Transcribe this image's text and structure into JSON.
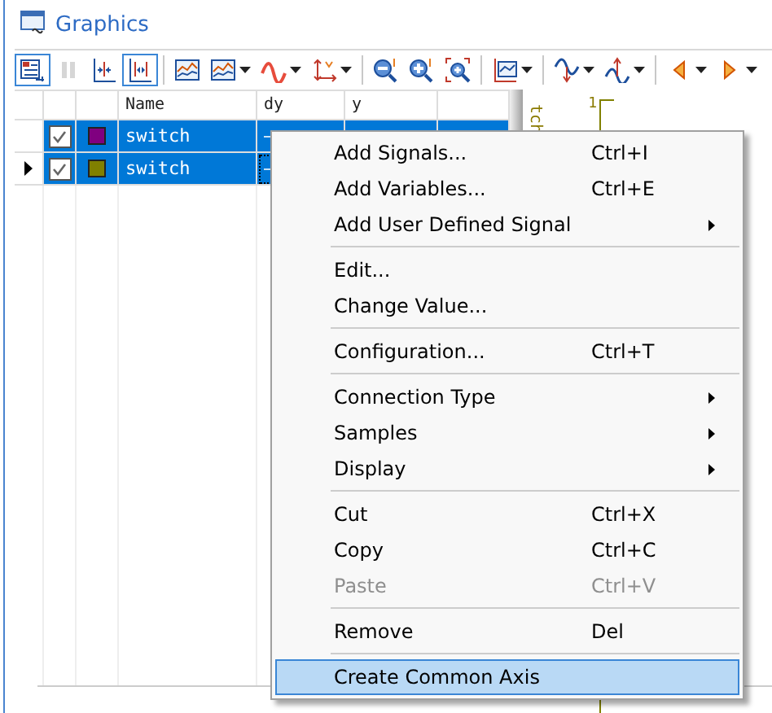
{
  "window": {
    "title": "Graphics"
  },
  "toolbar": [
    {
      "kind": "signal-list",
      "selected": true,
      "disabled": false,
      "dropdown": false
    },
    {
      "kind": "pause",
      "selected": false,
      "disabled": true,
      "dropdown": false
    },
    {
      "kind": "fit-x",
      "selected": false,
      "disabled": false,
      "dropdown": false
    },
    {
      "kind": "fit-x-marks",
      "selected": true,
      "disabled": false,
      "dropdown": false
    },
    {
      "kind": "separator"
    },
    {
      "kind": "chart",
      "selected": false,
      "disabled": false,
      "dropdown": false
    },
    {
      "kind": "chart",
      "selected": false,
      "disabled": false,
      "dropdown": true
    },
    {
      "kind": "wave",
      "selected": false,
      "disabled": false,
      "dropdown": true
    },
    {
      "kind": "xy-arrows",
      "selected": false,
      "disabled": false,
      "dropdown": true
    },
    {
      "kind": "separator"
    },
    {
      "kind": "zoom-out",
      "selected": false,
      "disabled": false,
      "dropdown": false
    },
    {
      "kind": "zoom-in",
      "selected": false,
      "disabled": false,
      "dropdown": false
    },
    {
      "kind": "zoom-rect",
      "selected": false,
      "disabled": false,
      "dropdown": false
    },
    {
      "kind": "separator"
    },
    {
      "kind": "axis-chart",
      "selected": false,
      "disabled": false,
      "dropdown": true
    },
    {
      "kind": "separator"
    },
    {
      "kind": "wave-down",
      "selected": false,
      "disabled": false,
      "dropdown": true
    },
    {
      "kind": "wave-up",
      "selected": false,
      "disabled": false,
      "dropdown": true
    },
    {
      "kind": "separator"
    },
    {
      "kind": "prev",
      "selected": false,
      "disabled": false,
      "dropdown": true
    },
    {
      "kind": "next",
      "selected": false,
      "disabled": false,
      "dropdown": true
    }
  ],
  "table": {
    "columns": [
      "Name",
      "dy",
      "y"
    ],
    "rows": [
      {
        "checked": true,
        "color": "#800080",
        "name": "switch",
        "dy": "–",
        "selected": true,
        "current": false
      },
      {
        "checked": true,
        "color": "#808000",
        "name": "switch",
        "dy": "–",
        "selected": true,
        "current": true
      }
    ]
  },
  "plot": {
    "signal_label": "tch",
    "tick": "1"
  },
  "context_menu": [
    {
      "kind": "item",
      "label": "Add Signals...",
      "shortcut": "Ctrl+I",
      "submenu": false,
      "disabled": false,
      "selected": false
    },
    {
      "kind": "item",
      "label": "Add Variables...",
      "shortcut": "Ctrl+E",
      "submenu": false,
      "disabled": false,
      "selected": false
    },
    {
      "kind": "item",
      "label": "Add User Defined Signal",
      "submenu": true,
      "disabled": false,
      "selected": false
    },
    {
      "kind": "separator"
    },
    {
      "kind": "item",
      "label": "Edit...",
      "submenu": false,
      "disabled": false,
      "selected": false
    },
    {
      "kind": "item",
      "label": "Change Value...",
      "submenu": false,
      "disabled": false,
      "selected": false
    },
    {
      "kind": "separator"
    },
    {
      "kind": "item",
      "label": "Configuration...",
      "shortcut": "Ctrl+T",
      "submenu": false,
      "disabled": false,
      "selected": false
    },
    {
      "kind": "separator"
    },
    {
      "kind": "item",
      "label": "Connection Type",
      "submenu": true,
      "disabled": false,
      "selected": false
    },
    {
      "kind": "item",
      "label": "Samples",
      "submenu": true,
      "disabled": false,
      "selected": false
    },
    {
      "kind": "item",
      "label": "Display",
      "submenu": true,
      "disabled": false,
      "selected": false
    },
    {
      "kind": "separator"
    },
    {
      "kind": "item",
      "label": "Cut",
      "shortcut": "Ctrl+X",
      "submenu": false,
      "disabled": false,
      "selected": false
    },
    {
      "kind": "item",
      "label": "Copy",
      "shortcut": "Ctrl+C",
      "submenu": false,
      "disabled": false,
      "selected": false
    },
    {
      "kind": "item",
      "label": "Paste",
      "shortcut": "Ctrl+V",
      "submenu": false,
      "disabled": true,
      "selected": false
    },
    {
      "kind": "separator"
    },
    {
      "kind": "item",
      "label": "Remove",
      "shortcut": "Del",
      "submenu": false,
      "disabled": false,
      "selected": false
    },
    {
      "kind": "separator"
    },
    {
      "kind": "item",
      "label": "Create Common Axis",
      "submenu": false,
      "disabled": false,
      "selected": true
    }
  ]
}
